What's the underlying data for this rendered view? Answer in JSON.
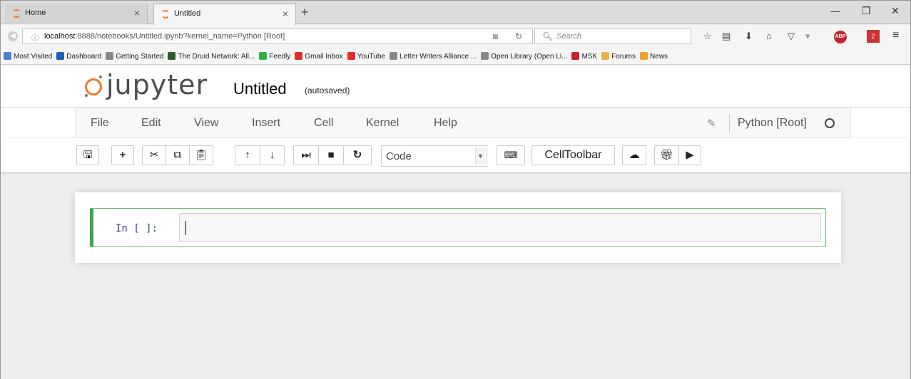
{
  "tabs": [
    {
      "label": "Home",
      "active": false
    },
    {
      "label": "Untitled",
      "active": true
    }
  ],
  "nav": {
    "url_host": "localhost",
    "url_rest": ":8888/notebooks/Untitled.ipynb?kernel_name=Python [Root]",
    "search_placeholder": "Search",
    "abp_label": "ABP",
    "badge_count": "2"
  },
  "bookmarks": [
    {
      "label": "Most Visited",
      "icon": "page-icon",
      "color": "#4a7fd4"
    },
    {
      "label": "Dashboard",
      "icon": "dashboard-icon",
      "color": "#1a5fb4"
    },
    {
      "label": "Getting Started",
      "icon": "globe-icon",
      "color": "#888888"
    },
    {
      "label": "The Druid Network: All...",
      "icon": "tree-icon",
      "color": "#2e5a2e"
    },
    {
      "label": "Feedly",
      "icon": "feedly-icon",
      "color": "#2bb24c"
    },
    {
      "label": "Gmail Inbox",
      "icon": "gmail-icon",
      "color": "#d93025"
    },
    {
      "label": "YouTube",
      "icon": "youtube-icon",
      "color": "#e52d27"
    },
    {
      "label": "Letter Writers Alliance ...",
      "icon": "globe-icon",
      "color": "#888888"
    },
    {
      "label": "Open Library (Open Li...",
      "icon": "globe-icon",
      "color": "#888888"
    },
    {
      "label": "MSK",
      "icon": "msk-icon",
      "color": "#c0262d"
    },
    {
      "label": "Forums",
      "icon": "folder-icon",
      "color": "#e8b44a"
    },
    {
      "label": "News",
      "icon": "rss-icon",
      "color": "#f0a030"
    }
  ],
  "jupyter": {
    "logo_text": "jupyter",
    "notebook_name": "Untitled",
    "autosave": "(autosaved)",
    "logo_color": "#f37626"
  },
  "menu": {
    "items": [
      "File",
      "Edit",
      "View",
      "Insert",
      "Cell",
      "Kernel",
      "Help"
    ],
    "kernel": "Python [Root]"
  },
  "toolbar": {
    "cell_type": "Code",
    "celltoolbar_label": "CellToolbar",
    "buttons": [
      "save-icon",
      "add-cell-icon",
      "cut-icon",
      "copy-icon",
      "paste-icon",
      "move-up-icon",
      "move-down-icon",
      "run-icon",
      "stop-icon",
      "restart-icon",
      "keyboard-icon",
      "upload-icon",
      "gift-icon",
      "present-icon"
    ]
  },
  "cell": {
    "prompt": "In [ ]:",
    "content": ""
  }
}
